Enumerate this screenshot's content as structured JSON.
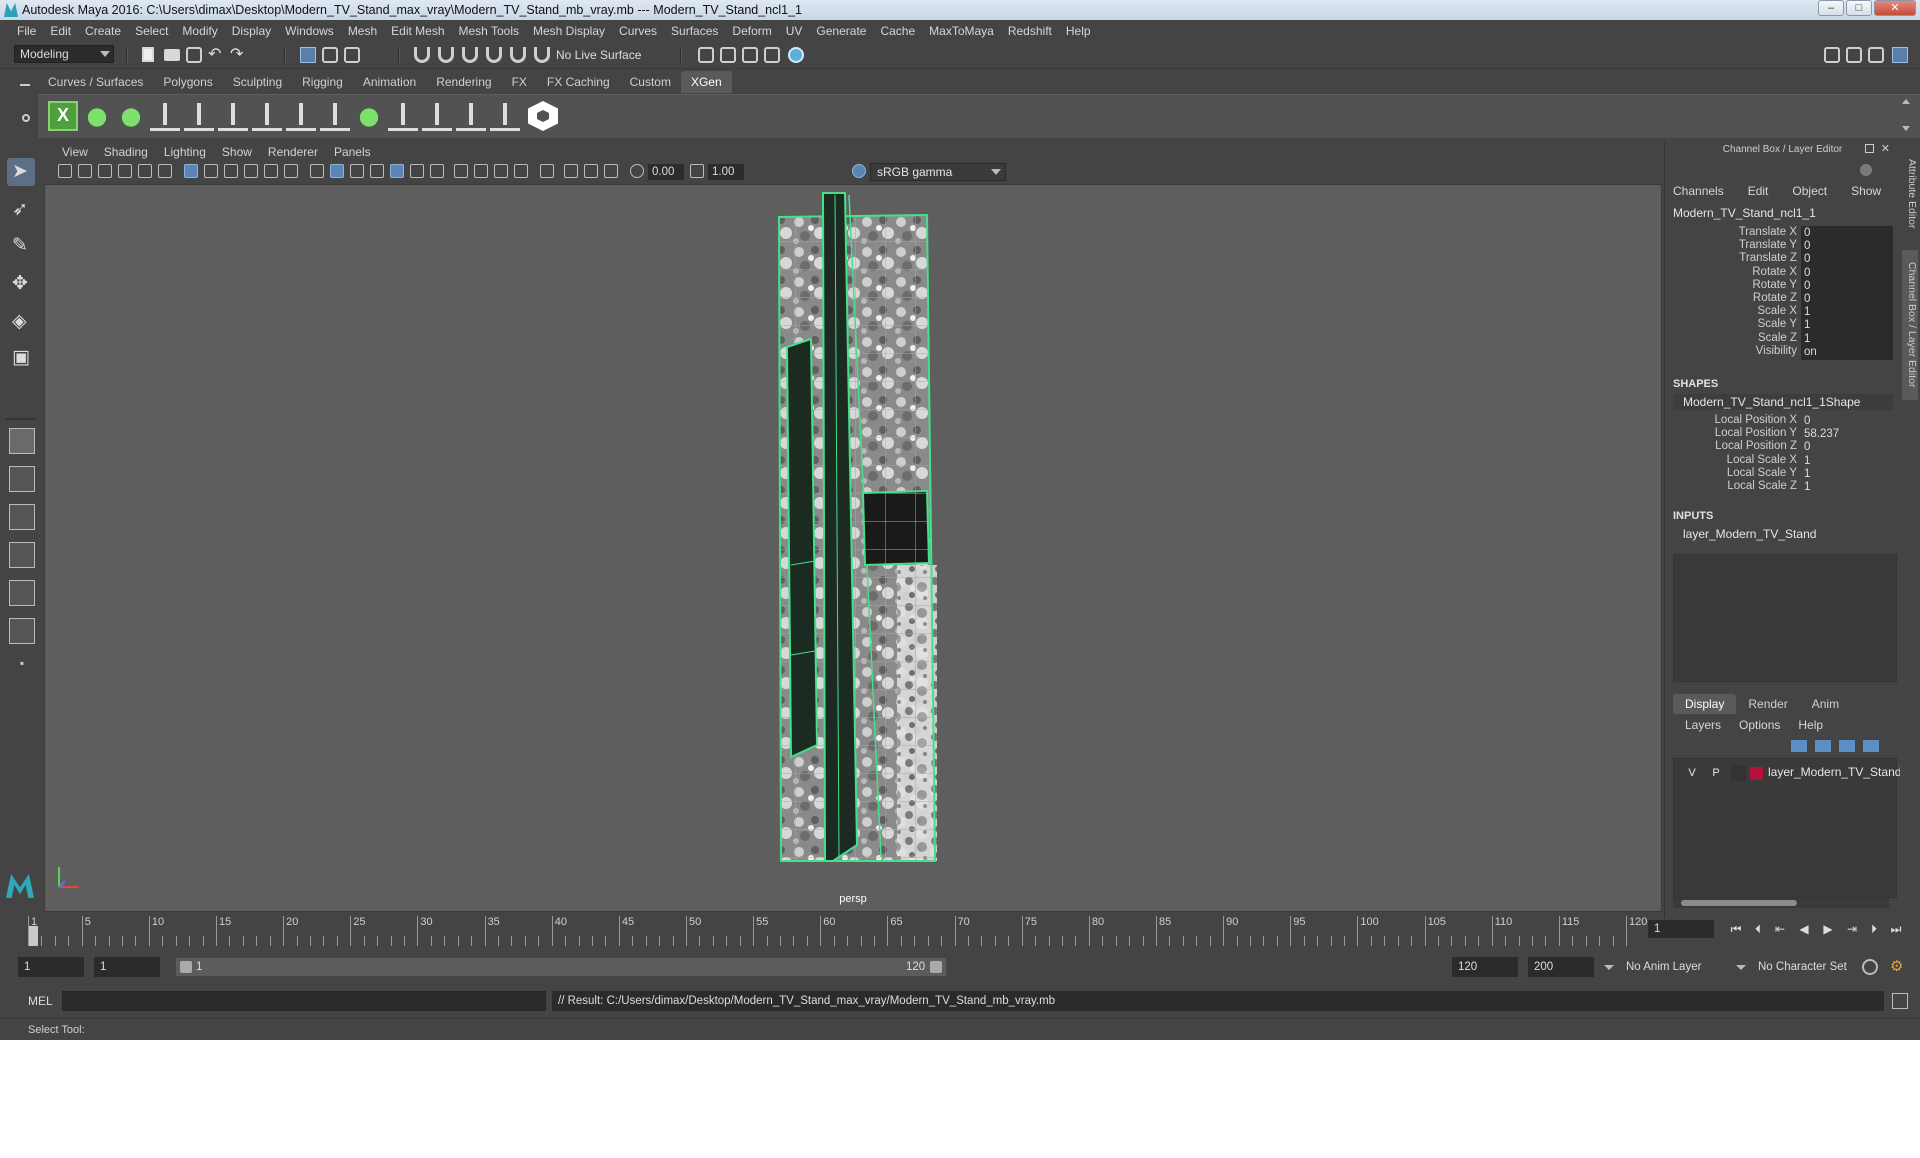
{
  "window": {
    "title": "Autodesk Maya 2016: C:\\Users\\dimax\\Desktop\\Modern_TV_Stand_max_vray\\Modern_TV_Stand_mb_vray.mb   ---   Modern_TV_Stand_ncl1_1"
  },
  "menus": [
    "File",
    "Edit",
    "Create",
    "Select",
    "Modify",
    "Display",
    "Windows",
    "Mesh",
    "Edit Mesh",
    "Mesh Tools",
    "Mesh Display",
    "Curves",
    "Surfaces",
    "Deform",
    "UV",
    "Generate",
    "Cache",
    "MaxToMaya",
    "Redshift",
    "Help"
  ],
  "statusline": {
    "mode": "Modeling",
    "live_surface": "No Live Surface"
  },
  "shelf": {
    "tabs": [
      "Curves / Surfaces",
      "Polygons",
      "Sculpting",
      "Rigging",
      "Animation",
      "Rendering",
      "FX",
      "FX Caching",
      "Custom",
      "XGen"
    ],
    "active_tab": "XGen"
  },
  "viewport": {
    "menus": [
      "View",
      "Shading",
      "Lighting",
      "Show",
      "Renderer",
      "Panels"
    ],
    "exposure": "0.00",
    "gamma": "1.00",
    "color_management": "sRGB gamma",
    "camera": "persp"
  },
  "channel_box": {
    "title": "Channel Box / Layer Editor",
    "menus": [
      "Channels",
      "Edit",
      "Object",
      "Show"
    ],
    "object": "Modern_TV_Stand_ncl1_1",
    "transform_attrs": [
      {
        "label": "Translate X",
        "value": "0"
      },
      {
        "label": "Translate Y",
        "value": "0"
      },
      {
        "label": "Translate Z",
        "value": "0"
      },
      {
        "label": "Rotate X",
        "value": "0"
      },
      {
        "label": "Rotate Y",
        "value": "0"
      },
      {
        "label": "Rotate Z",
        "value": "0"
      },
      {
        "label": "Scale X",
        "value": "1"
      },
      {
        "label": "Scale Y",
        "value": "1"
      },
      {
        "label": "Scale Z",
        "value": "1"
      },
      {
        "label": "Visibility",
        "value": "on"
      }
    ],
    "shapes_header": "SHAPES",
    "shape_name": "Modern_TV_Stand_ncl1_1Shape",
    "shape_attrs": [
      {
        "label": "Local Position X",
        "value": "0"
      },
      {
        "label": "Local Position Y",
        "value": "58.237"
      },
      {
        "label": "Local Position Z",
        "value": "0"
      },
      {
        "label": "Local Scale X",
        "value": "1"
      },
      {
        "label": "Local Scale Y",
        "value": "1"
      },
      {
        "label": "Local Scale Z",
        "value": "1"
      }
    ],
    "inputs_header": "INPUTS",
    "input_name": "layer_Modern_TV_Stand"
  },
  "layer_editor": {
    "tabs": [
      "Display",
      "Render",
      "Anim"
    ],
    "active_tab": "Display",
    "menus": [
      "Layers",
      "Options",
      "Help"
    ],
    "layer": {
      "v": "V",
      "p": "P",
      "name": "layer_Modern_TV_Stand",
      "color": "#b4123a"
    }
  },
  "side_tabs": [
    "Attribute Editor",
    "Channel Box / Layer Editor"
  ],
  "timeline": {
    "ticks": [
      "1",
      "5",
      "10",
      "15",
      "20",
      "25",
      "30",
      "35",
      "40",
      "45",
      "50",
      "55",
      "60",
      "65",
      "70",
      "75",
      "80",
      "85",
      "90",
      "95",
      "100",
      "105",
      "110",
      "115",
      "120"
    ],
    "current_frame": "1"
  },
  "range": {
    "start": "1",
    "playback_start": "1",
    "slider_start": "1",
    "slider_end": "120",
    "playback_end": "120",
    "end": "200",
    "anim_layer": "No Anim Layer",
    "character_set": "No Character Set"
  },
  "command_line": {
    "lang": "MEL",
    "result": "// Result: C:/Users/dimax/Desktop/Modern_TV_Stand_max_vray/Modern_TV_Stand_mb_vray.mb"
  },
  "help_line": "Select Tool:",
  "colors": {
    "wire_accent": "#45e08a",
    "layer_swatch": "#b4123a"
  }
}
